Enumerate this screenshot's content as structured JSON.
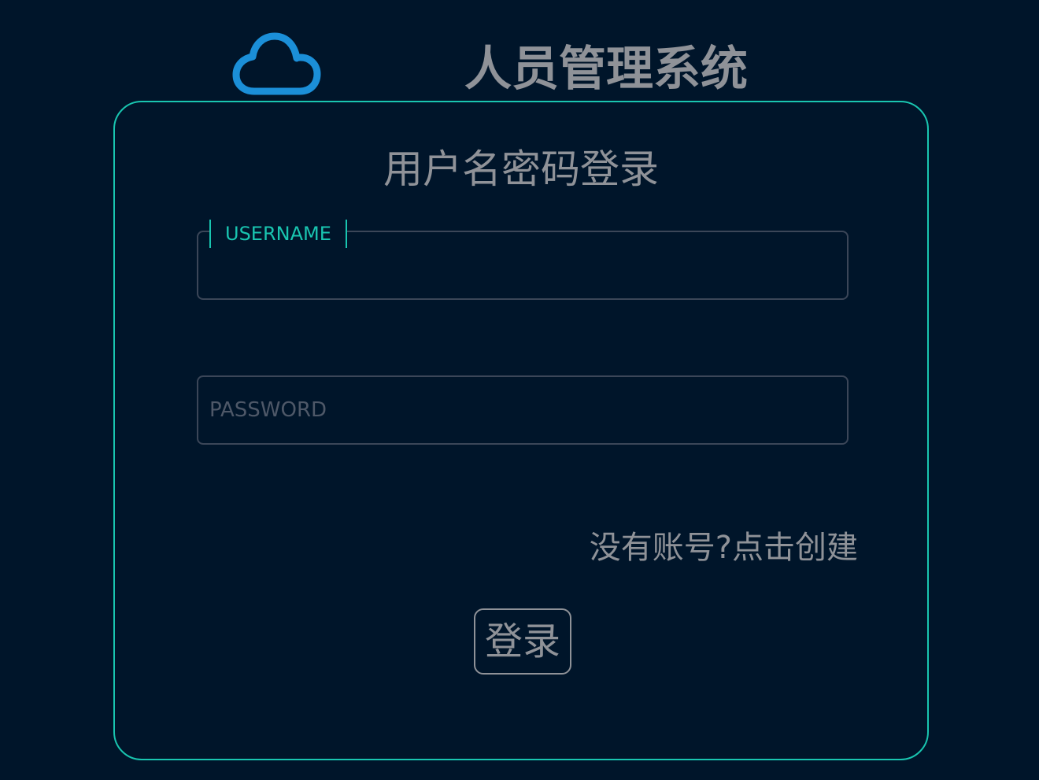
{
  "header": {
    "logo_icon": "cloud-icon",
    "title": "人员管理系统",
    "accent_color": "#1b8fd8"
  },
  "login_card": {
    "title": "用户名密码登录",
    "border_color": "#19c5b0",
    "username": {
      "label": "USERNAME",
      "value": ""
    },
    "password": {
      "placeholder": "PASSWORD",
      "value": ""
    },
    "register_link": "没有账号?点击创建",
    "login_button": "登录"
  }
}
